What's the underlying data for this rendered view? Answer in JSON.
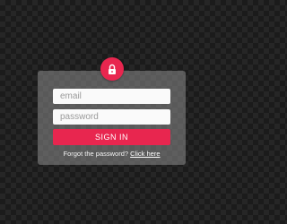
{
  "login": {
    "email_placeholder": "email",
    "password_placeholder": "password",
    "signin_label": "SIGN IN",
    "forgot_text": "Forgot the password?",
    "click_here_label": "Click here"
  },
  "icons": {
    "badge": "lock-icon"
  },
  "colors": {
    "accent": "#e8264f",
    "card": "#8c8c8c",
    "background": "#262626"
  }
}
